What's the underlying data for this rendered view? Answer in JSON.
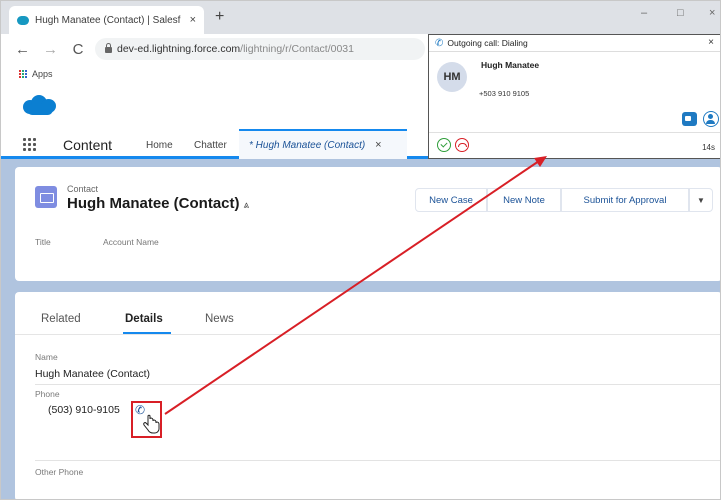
{
  "browser": {
    "tab_title": "Hugh Manatee (Contact) | Salesf",
    "tab_close": "×",
    "new_tab": "+",
    "url_host": "dev-ed.lightning.force.com",
    "url_path": "/lightning/r/Contact/0031",
    "bookmarks_apps": "Apps",
    "window_controls": [
      "–",
      "□",
      "×"
    ]
  },
  "salesforce": {
    "app_name": "Content",
    "nav_items": [
      "Home",
      "Chatter"
    ],
    "active_tab": "* Hugh Manatee (Contact)",
    "active_tab_close": "×"
  },
  "record": {
    "object_label": "Contact",
    "name": "Hugh Manatee (Contact)",
    "hierarchy_glyph": "⩓",
    "actions": [
      "New Case",
      "New Note",
      "Submit for Approval"
    ],
    "more_glyph": "▼",
    "highlight_fields": [
      "Title",
      "Account Name"
    ]
  },
  "details": {
    "tabs": [
      "Related",
      "Details",
      "News"
    ],
    "active_tab_index": 1,
    "name_label": "Name",
    "name_value": "Hugh Manatee (Contact)",
    "phone_label": "Phone",
    "phone_value": "(503) 910-9105",
    "other_phone_label": "Other Phone"
  },
  "softphone": {
    "title": "Outgoing call: Dialing",
    "close": "×",
    "initials": "HM",
    "caller_name": "Hugh Manatee",
    "caller_number": "+503 910 9105",
    "timer": "14s"
  },
  "colors": {
    "accent": "#1589ee",
    "highlight_red": "#d81f26",
    "page_background": "#b0c4df",
    "avatar_bg": "#d4dcea"
  },
  "icons": {
    "click_to_dial": "phone-icon",
    "cursor": "hand-pointer-icon",
    "annotation": "red-arrow"
  }
}
